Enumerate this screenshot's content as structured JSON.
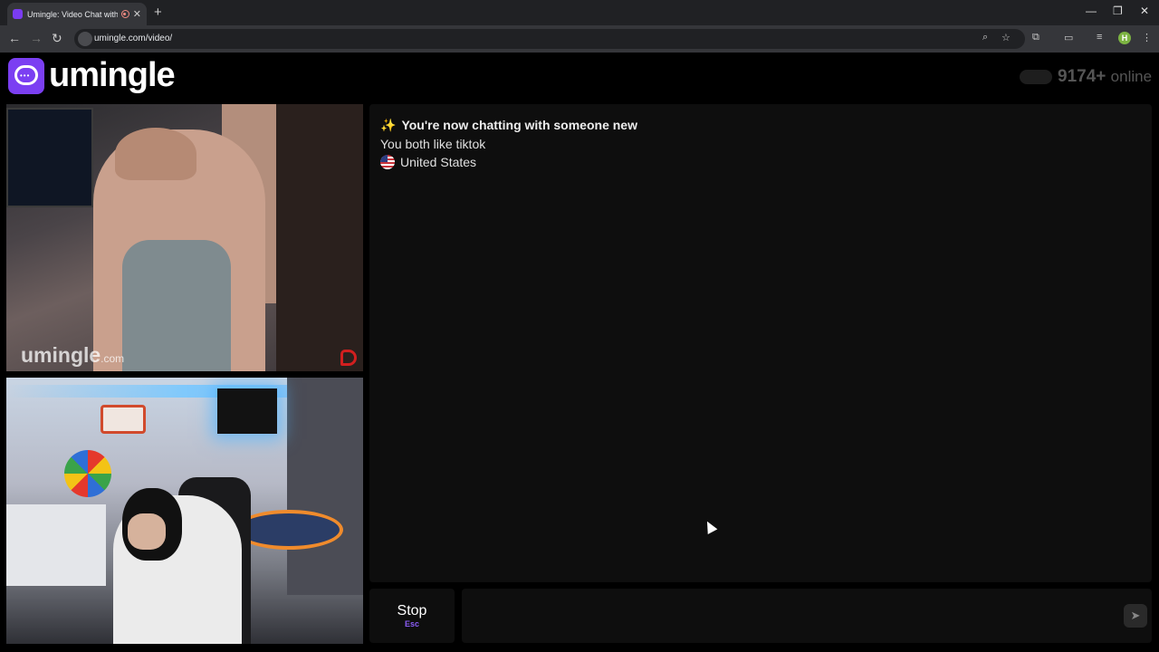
{
  "browser": {
    "tab_title": "Umingle: Video Chat with S",
    "tab_close": "✕",
    "new_tab": "+",
    "url": "umingle.com/video/",
    "profile_initial": "H"
  },
  "header": {
    "logo_text": "umingle",
    "online_count": "9174+",
    "online_label": "online"
  },
  "videos": {
    "watermark": "umingle",
    "watermark_suffix": ".com"
  },
  "chat": {
    "new_chat_text": "You're now chatting with someone new",
    "common_interest": "You both like tiktok",
    "country": "United States"
  },
  "controls": {
    "stop_label": "Stop",
    "stop_key": "Esc",
    "message_placeholder": ""
  },
  "colors": {
    "brand": "#7b3ff2",
    "background": "#000000",
    "panel": "#0e0e0e"
  }
}
